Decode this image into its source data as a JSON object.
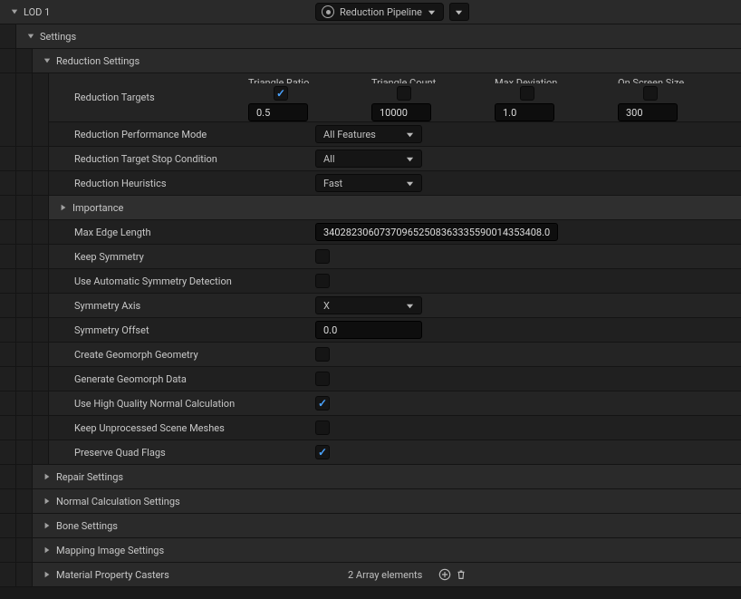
{
  "header": {
    "title": "LOD 1",
    "pipeline": "Reduction Pipeline"
  },
  "sections": {
    "settings": "Settings",
    "reduction_settings": "Reduction Settings",
    "repair": "Repair Settings",
    "normal_calc": "Normal Calculation Settings",
    "bone": "Bone Settings",
    "mapping_image": "Mapping Image Settings",
    "material_casters": {
      "label": "Material Property Casters",
      "value": "2 Array elements"
    }
  },
  "reduction": {
    "targets_label": "Reduction Targets",
    "targets": {
      "triangle_ratio": {
        "label": "Triangle Ratio",
        "checked": true,
        "value": "0.5"
      },
      "triangle_count": {
        "label": "Triangle Count",
        "checked": false,
        "value": "10000"
      },
      "max_deviation": {
        "label": "Max Deviation",
        "checked": false,
        "value": "1.0"
      },
      "on_screen_size": {
        "label": "On Screen Size",
        "checked": false,
        "value": "300"
      }
    },
    "performance_mode": {
      "label": "Reduction Performance Mode",
      "value": "All Features"
    },
    "stop_condition": {
      "label": "Reduction Target Stop Condition",
      "value": "All"
    },
    "heuristics": {
      "label": "Reduction Heuristics",
      "value": "Fast"
    },
    "importance": {
      "label": "Importance"
    },
    "max_edge_length": {
      "label": "Max Edge Length",
      "value": "340282306073709652508363335590014353408.0"
    },
    "keep_symmetry": {
      "label": "Keep Symmetry",
      "checked": false
    },
    "auto_symmetry": {
      "label": "Use Automatic Symmetry Detection",
      "checked": false
    },
    "symmetry_axis": {
      "label": "Symmetry Axis",
      "value": "X"
    },
    "symmetry_offset": {
      "label": "Symmetry Offset",
      "value": "0.0"
    },
    "create_geomorph": {
      "label": "Create Geomorph Geometry",
      "checked": false
    },
    "generate_geomorph": {
      "label": "Generate Geomorph Data",
      "checked": false
    },
    "hq_normal": {
      "label": "Use High Quality Normal Calculation",
      "checked": true
    },
    "keep_unprocessed": {
      "label": "Keep Unprocessed Scene Meshes",
      "checked": false
    },
    "preserve_quad": {
      "label": "Preserve Quad Flags",
      "checked": true
    }
  }
}
